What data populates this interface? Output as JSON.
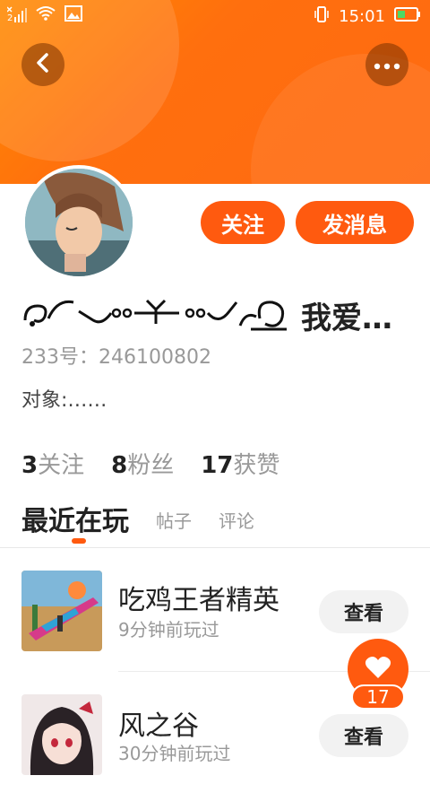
{
  "status_bar": {
    "time": "15:01",
    "sim_badge": "2"
  },
  "profile": {
    "name": "我爱…",
    "id_line": "233号：246100802",
    "bio": "对象:……"
  },
  "actions": {
    "follow_label": "关注",
    "message_label": "发消息"
  },
  "stats": [
    {
      "num": "3",
      "label": "关注"
    },
    {
      "num": "8",
      "label": "粉丝"
    },
    {
      "num": "17",
      "label": "获赞"
    }
  ],
  "tabs": [
    {
      "label": "最近在玩",
      "active": true
    },
    {
      "label": "帖子",
      "active": false
    },
    {
      "label": "评论",
      "active": false
    }
  ],
  "games": [
    {
      "title": "吃鸡王者精英",
      "subtitle": "9分钟前玩过",
      "button": "查看"
    },
    {
      "title": "风之谷",
      "subtitle": "30分钟前玩过",
      "button": "查看"
    }
  ],
  "like_fab": {
    "count": "17"
  },
  "colors": {
    "accent": "#ff5a0f",
    "header_gradient_start": "#ff8a00",
    "header_gradient_end": "#ff6a12"
  },
  "icons": {
    "back": "back-arrow-icon",
    "more": "more-dots-icon",
    "like": "heart-icon"
  }
}
